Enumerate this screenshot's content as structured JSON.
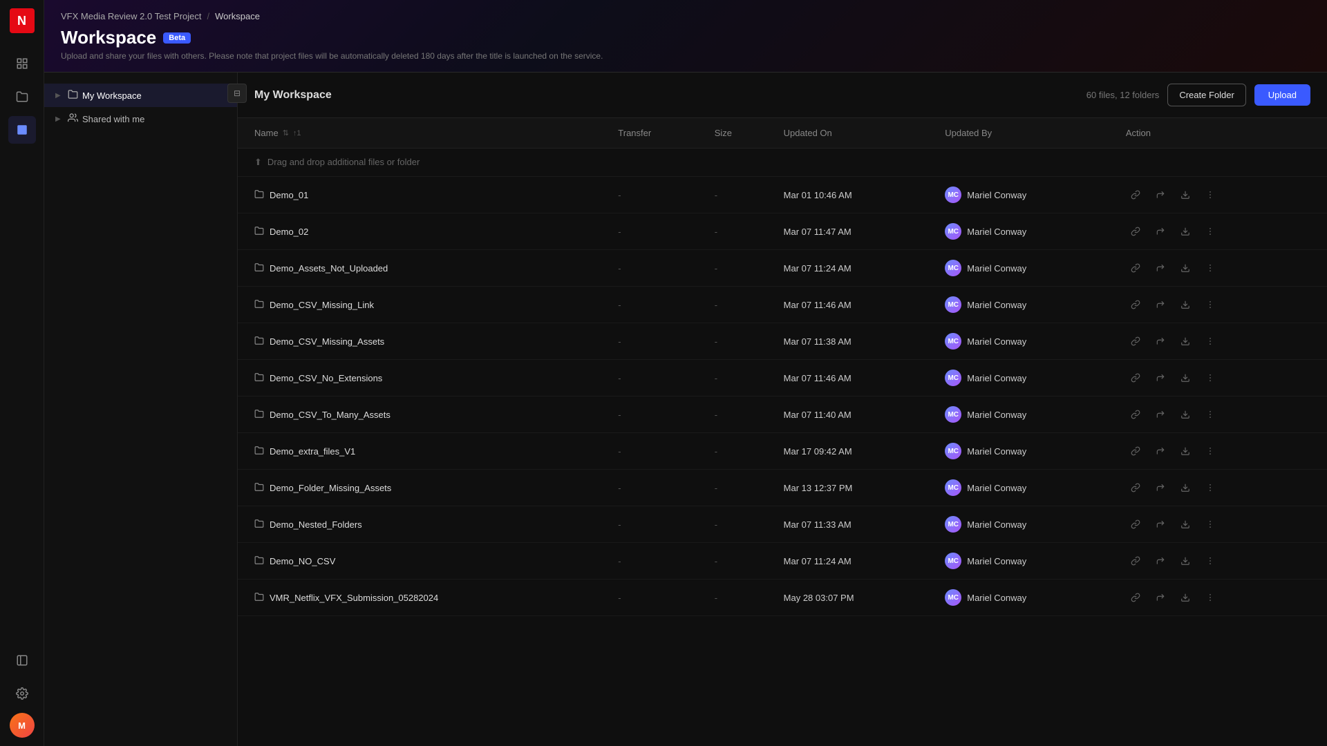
{
  "app": {
    "logo": "N",
    "breadcrumb": {
      "project": "VFX Media Review 2.0 Test Project",
      "separator": "/",
      "current": "Workspace"
    },
    "page_title": "Workspace",
    "beta_label": "Beta",
    "subtitle": "Upload and share your files with others. Please note that project files will be automatically deleted 180 days after the title is launched on the service."
  },
  "sidebar": {
    "toggle_icon": "⊟",
    "items": [
      {
        "id": "my-workspace",
        "label": "My Workspace",
        "icon": "folder",
        "arrow": "▶",
        "active": true
      },
      {
        "id": "shared",
        "label": "Shared with me",
        "icon": "group",
        "arrow": "▶",
        "active": false
      }
    ]
  },
  "nav_icons": [
    {
      "id": "dashboard",
      "icon": "⊞",
      "active": false
    },
    {
      "id": "folder",
      "icon": "📁",
      "active": false
    },
    {
      "id": "workspace",
      "icon": "⬛",
      "active": true
    }
  ],
  "bottom_nav_icons": [
    {
      "id": "panel",
      "icon": "⊟"
    },
    {
      "id": "settings",
      "icon": "⚙"
    }
  ],
  "workspace": {
    "title": "My Workspace",
    "file_count": "60 files, 12 folders",
    "create_folder_label": "Create Folder",
    "upload_label": "Upload"
  },
  "table": {
    "columns": [
      {
        "id": "name",
        "label": "Name",
        "sort": true
      },
      {
        "id": "transfer",
        "label": "Transfer"
      },
      {
        "id": "size",
        "label": "Size"
      },
      {
        "id": "updated_on",
        "label": "Updated On"
      },
      {
        "id": "updated_by",
        "label": "Updated By"
      },
      {
        "id": "action",
        "label": "Action"
      }
    ],
    "drag_row_label": "Drag and drop additional files or folder",
    "rows": [
      {
        "name": "Demo_01",
        "transfer": "-",
        "size": "-",
        "updated_on": "Mar 01 10:46 AM",
        "updated_by": "Mariel Conway",
        "avatar": "MC"
      },
      {
        "name": "Demo_02",
        "transfer": "-",
        "size": "-",
        "updated_on": "Mar 07 11:47 AM",
        "updated_by": "Mariel Conway",
        "avatar": "MC"
      },
      {
        "name": "Demo_Assets_Not_Uploaded",
        "transfer": "-",
        "size": "-",
        "updated_on": "Mar 07 11:24 AM",
        "updated_by": "Mariel Conway",
        "avatar": "MC"
      },
      {
        "name": "Demo_CSV_Missing_Link",
        "transfer": "-",
        "size": "-",
        "updated_on": "Mar 07 11:46 AM",
        "updated_by": "Mariel Conway",
        "avatar": "MC"
      },
      {
        "name": "Demo_CSV_Missing_Assets",
        "transfer": "-",
        "size": "-",
        "updated_on": "Mar 07 11:38 AM",
        "updated_by": "Mariel Conway",
        "avatar": "MC"
      },
      {
        "name": "Demo_CSV_No_Extensions",
        "transfer": "-",
        "size": "-",
        "updated_on": "Mar 07 11:46 AM",
        "updated_by": "Mariel Conway",
        "avatar": "MC"
      },
      {
        "name": "Demo_CSV_To_Many_Assets",
        "transfer": "-",
        "size": "-",
        "updated_on": "Mar 07 11:40 AM",
        "updated_by": "Mariel Conway",
        "avatar": "MC"
      },
      {
        "name": "Demo_extra_files_V1",
        "transfer": "-",
        "size": "-",
        "updated_on": "Mar 17 09:42 AM",
        "updated_by": "Mariel Conway",
        "avatar": "MC"
      },
      {
        "name": "Demo_Folder_Missing_Assets",
        "transfer": "-",
        "size": "-",
        "updated_on": "Mar 13 12:37 PM",
        "updated_by": "Mariel Conway",
        "avatar": "MC"
      },
      {
        "name": "Demo_Nested_Folders",
        "transfer": "-",
        "size": "-",
        "updated_on": "Mar 07 11:33 AM",
        "updated_by": "Mariel Conway",
        "avatar": "MC"
      },
      {
        "name": "Demo_NO_CSV",
        "transfer": "-",
        "size": "-",
        "updated_on": "Mar 07 11:24 AM",
        "updated_by": "Mariel Conway",
        "avatar": "MC"
      },
      {
        "name": "VMR_Netflix_VFX_Submission_05282024",
        "transfer": "-",
        "size": "-",
        "updated_on": "May 28 03:07 PM",
        "updated_by": "Mariel Conway",
        "avatar": "MC"
      }
    ]
  }
}
